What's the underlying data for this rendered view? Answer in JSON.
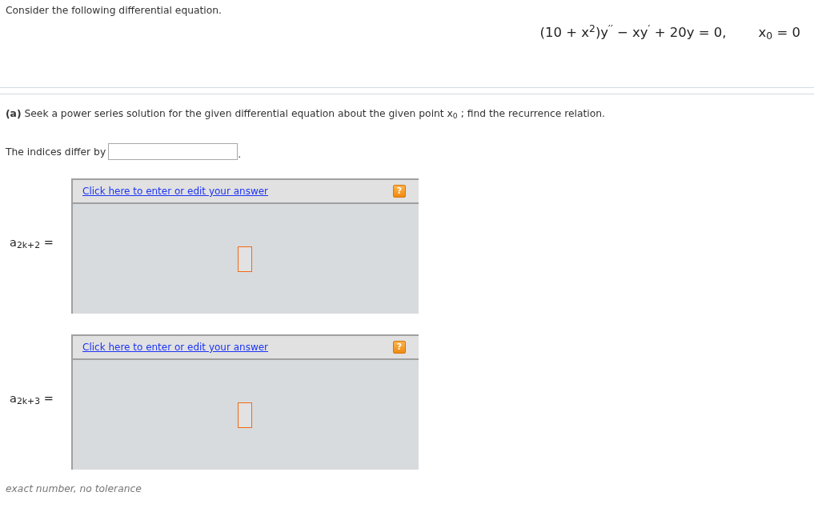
{
  "intro": "Consider the following differential equation.",
  "equation": {
    "formula": "(10 + x$^{2}$)y$^{′′}$ − xy$^{′}$ + 20y = 0,",
    "point": "x$_{0}$ = 0"
  },
  "part_a": {
    "text": "**(a)** Seek a power series solution for the given differential equation about the given point  x$_{0}$ ; find the recurrence relation."
  },
  "indices": {
    "label": "The indices differ by",
    "suffix": "."
  },
  "answers": [
    {
      "label": "a$_{2k+2}$ =",
      "link": "Click here to enter or edit your answer",
      "help": "?"
    },
    {
      "label": "a$_{2k+3}$ =",
      "link": "Click here to enter or edit your answer",
      "help": "?"
    }
  ],
  "note": "exact number, no tolerance"
}
